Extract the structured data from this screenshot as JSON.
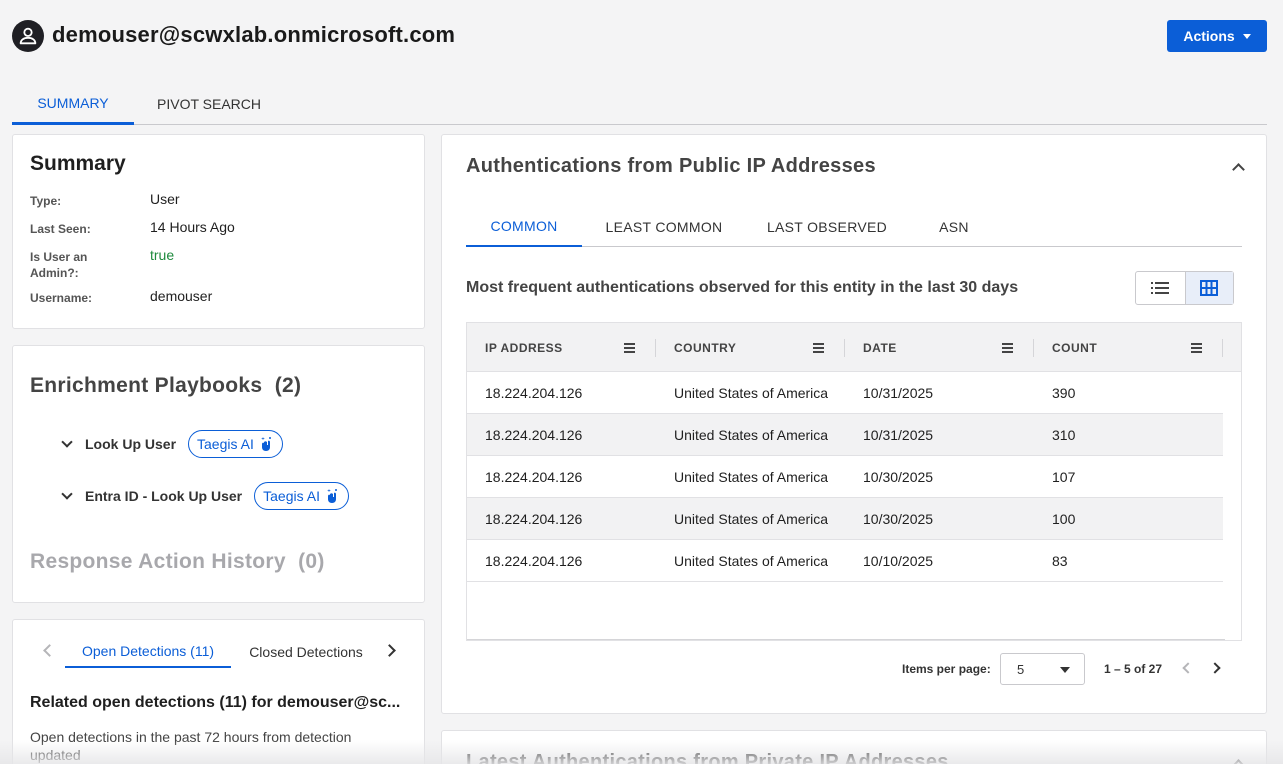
{
  "header": {
    "entity_icon": "user-icon",
    "title": "demouser@scwxlab.onmicrosoft.com",
    "actions_label": "Actions"
  },
  "tabs": [
    {
      "label": "SUMMARY",
      "active": true
    },
    {
      "label": "PIVOT SEARCH",
      "active": false
    }
  ],
  "summary": {
    "title": "Summary",
    "fields": [
      {
        "label": "Type:",
        "value": "User"
      },
      {
        "label": "Last Seen:",
        "value": "14 Hours Ago"
      },
      {
        "label": "Is User an Admin?:",
        "value": "true"
      },
      {
        "label": "Username:",
        "value": "demouser"
      }
    ]
  },
  "enrichment": {
    "title": "Enrichment Playbooks",
    "count": "(2)",
    "playbooks": [
      {
        "name": "Look Up User",
        "badge": "Taegis AI"
      },
      {
        "name": "Entra ID - Look Up User",
        "badge": "Taegis AI"
      }
    ],
    "response_title": "Response Action History",
    "response_count": "(0)"
  },
  "detections": {
    "tabs": [
      "Open Detections (11)",
      "Closed Detections"
    ],
    "heading": "Related open detections (11) for demouser@sc...",
    "description": "Open detections in the past 72 hours from detection updated"
  },
  "auth_public": {
    "title": "Authentications from Public IP Addresses",
    "tabs": [
      "COMMON",
      "LEAST COMMON",
      "LAST OBSERVED",
      "ASN"
    ],
    "description": "Most frequent authentications observed for this entity in the last 30 days",
    "columns": [
      "IP ADDRESS",
      "COUNTRY",
      "DATE",
      "COUNT"
    ],
    "rows": [
      [
        "18.224.204.126",
        "United States of America",
        "10/31/2025",
        "390"
      ],
      [
        "18.224.204.126",
        "United States of America",
        "10/31/2025",
        "310"
      ],
      [
        "18.224.204.126",
        "United States of America",
        "10/30/2025",
        "107"
      ],
      [
        "18.224.204.126",
        "United States of America",
        "10/30/2025",
        "100"
      ],
      [
        "18.224.204.126",
        "United States of America",
        "10/10/2025",
        "83"
      ]
    ],
    "pagination": {
      "label": "Items per page:",
      "per_page": "5",
      "range": "1 – 5 of 27"
    }
  },
  "auth_private": {
    "title": "Latest Authentications from Private IP Addresses"
  },
  "colors": {
    "accent": "#0b5ed7",
    "admin_true": "#1e8a3d",
    "background": "#f4f4f5"
  }
}
